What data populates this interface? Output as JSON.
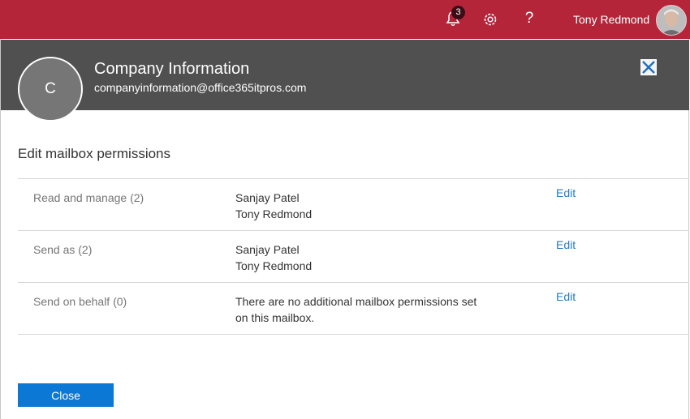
{
  "topbar": {
    "notification_count": "3",
    "user_name": "Tony Redmond",
    "help_glyph": "?",
    "icons": [
      "bell-icon",
      "gear-icon",
      "help-icon"
    ],
    "color": "#b4253a"
  },
  "panel": {
    "avatar_letter": "C",
    "name": "Company Information",
    "email": "companyinformation@office365itpros.com",
    "header_color": "#505050"
  },
  "permissions": {
    "title": "Edit mailbox permissions",
    "rows": [
      {
        "label": "Read and manage (2)",
        "value_lines": [
          "Sanjay Patel",
          "Tony Redmond"
        ],
        "edit": "Edit"
      },
      {
        "label": "Send as (2)",
        "value_lines": [
          "Sanjay Patel",
          "Tony Redmond"
        ],
        "edit": "Edit"
      },
      {
        "label": "Send on behalf (0)",
        "value_lines": [
          "There are no additional mailbox permissions set",
          "on this mailbox."
        ],
        "edit": "Edit"
      }
    ]
  },
  "footer": {
    "close_label": "Close",
    "button_color": "#0a78d4"
  }
}
